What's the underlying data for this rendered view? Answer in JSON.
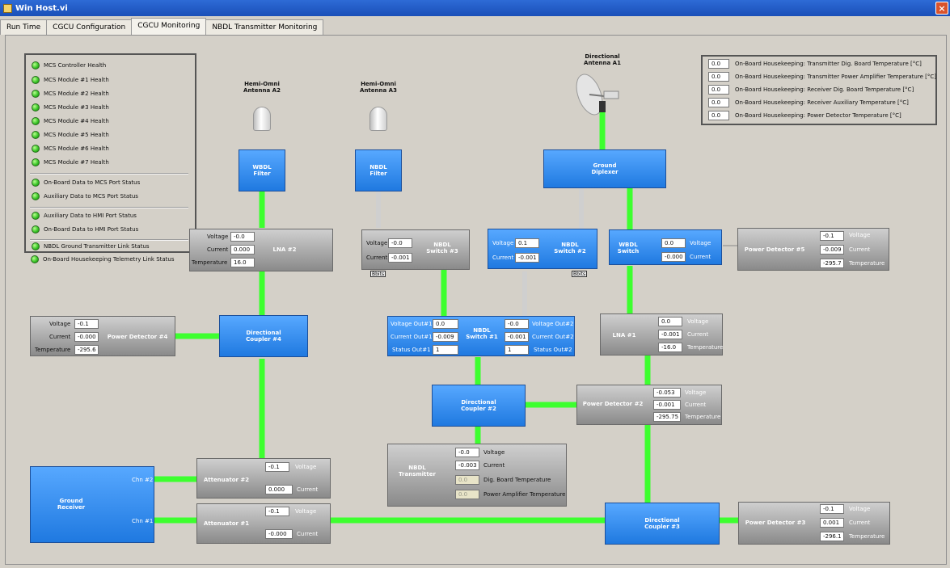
{
  "window": {
    "title": "Win Host.vi",
    "close": "×"
  },
  "tabs": [
    "Run Time",
    "CGCU Configuration",
    "CGCU Monitoring",
    "NBDL Transmitter Monitoring"
  ],
  "status_leds": [
    "MCS Controller Health",
    "MCS Module #1 Health",
    "MCS Module #2 Health",
    "MCS Module #3 Health",
    "MCS Module #4 Health",
    "MCS Module #5 Health",
    "MCS Module #6 Health",
    "MCS Module #7 Health",
    "On-Board Data to MCS Port Status",
    "Auxiliary Data to MCS Port Status",
    "Auxiliary Data to HMI Port Status",
    "On-Board Data to HMI Port Status",
    "NBDL Ground Transmitter Link Status",
    "On-Board Housekeeping Telemetry Link Status"
  ],
  "housekeeping": [
    {
      "value": "0.0",
      "label": "On-Board Housekeeping: Transmitter Dig. Board Temperature [°C]"
    },
    {
      "value": "0.0",
      "label": "On-Board Housekeeping: Transmitter Power Amplifier Temperature [°C]"
    },
    {
      "value": "0.0",
      "label": "On-Board Housekeeping: Receiver Dig. Board Temperature [°C]"
    },
    {
      "value": "0.0",
      "label": "On-Board Housekeeping: Receiver Auxiliary Temperature [°C]"
    },
    {
      "value": "0.0",
      "label": "On-Board Housekeeping: Power Detector Temperature [°C]"
    }
  ],
  "antennas": {
    "a2": "Hemi-Omni\nAntenna A2",
    "a3": "Hemi-Omni\nAntenna A3",
    "a1": "Directional\nAntenna A1"
  },
  "blocks": {
    "wbdl_filter": "WBDL\nFilter",
    "nbdl_filter": "NBDL\nFilter",
    "ground_diplexer": "Ground\nDiplexer",
    "wbdl_switch": "WBDL\nSwitch",
    "dir_coupler_4": "Directional\nCoupler #4",
    "dir_coupler_2": "Directional\nCoupler #2",
    "dir_coupler_3": "Directional\nCoupler #3",
    "ground_receiver": "Ground\nReceiver",
    "chn2": "Chn #2",
    "chn1": "Chn #1"
  },
  "lna2": {
    "title": "LNA #2",
    "voltage_label": "Voltage",
    "voltage": "-0.0",
    "current_label": "Current",
    "current": "0.000",
    "temp_label": "Temperature",
    "temp": "16.0"
  },
  "nbdl_switch3": {
    "title": "NBDL\nSwitch #3",
    "voltage_label": "Voltage",
    "voltage": "-0.0",
    "current_label": "Current",
    "current": "-0.001",
    "bits": "Bbits"
  },
  "nbdl_switch2": {
    "title": "NBDL\nSwitch #2",
    "voltage_label": "Voltage",
    "voltage": "0.1",
    "current_label": "Current",
    "current": "-0.001",
    "bits": "Bbits"
  },
  "wbdl_switch_vals": {
    "voltage_label": "Voltage",
    "voltage": "0.0",
    "current_label": "Current",
    "current": "-0.000"
  },
  "pd5": {
    "title": "Power Detector #5",
    "voltage_label": "Voltage",
    "voltage": "-0.1",
    "current_label": "Current",
    "current": "-0.009",
    "temp_label": "Temperature",
    "temp": "-295.7"
  },
  "pd4": {
    "title": "Power Detector #4",
    "voltage_label": "Voltage",
    "voltage": "-0.1",
    "current_label": "Current",
    "current": "-0.000",
    "temp_label": "Temperature",
    "temp": "-295.6"
  },
  "nbdl_switch1": {
    "title": "NBDL\nSwitch #1",
    "vout1_label": "Voltage Out#1",
    "vout1": "0.0",
    "cout1_label": "Current Out#1",
    "cout1": "-0.009",
    "sout1_label": "Status Out#1",
    "sout1": "1",
    "vout2_label": "Voltage Out#2",
    "vout2": "-0.0",
    "cout2_label": "Current Out#2",
    "cout2": "-0.001",
    "sout2_label": "Status Out#2",
    "sout2": "1"
  },
  "lna1": {
    "title": "LNA #1",
    "voltage_label": "Voltage",
    "voltage": "0.0",
    "current_label": "Current",
    "current": "-0.001",
    "temp_label": "Temperature",
    "temp": "-16.0"
  },
  "pd2": {
    "title": "Power Detector #2",
    "voltage_label": "Voltage",
    "voltage": "-0.053",
    "current_label": "Current",
    "current": "-0.001",
    "temp_label": "Temperature",
    "temp": "-295.75"
  },
  "nbdl_tx": {
    "title": "NBDL\nTransmitter",
    "voltage_label": "Voltage",
    "voltage": "-0.0",
    "current_label": "Current",
    "current": "-0.003",
    "dig_label": "Dig. Board Temperature",
    "dig": "0.0",
    "pa_label": "Power Amplifier Temperature",
    "pa": "0.0"
  },
  "att2": {
    "title": "Attenuator #2",
    "voltage_label": "Voltage",
    "voltage": "-0.1",
    "current_label": "Current",
    "current": "0.000"
  },
  "att1": {
    "title": "Attenuator #1",
    "voltage_label": "Voltage",
    "voltage": "-0.1",
    "current_label": "Current",
    "current": "-0.000"
  },
  "pd3": {
    "title": "Power Detector #3",
    "voltage_label": "Voltage",
    "voltage": "-0.1",
    "current_label": "Current",
    "current": "0.001",
    "temp_label": "Temperature",
    "temp": "-296.1"
  },
  "colors": {
    "wire": "#3dff2f",
    "block": "#2a86ea",
    "led": "#33c022"
  }
}
